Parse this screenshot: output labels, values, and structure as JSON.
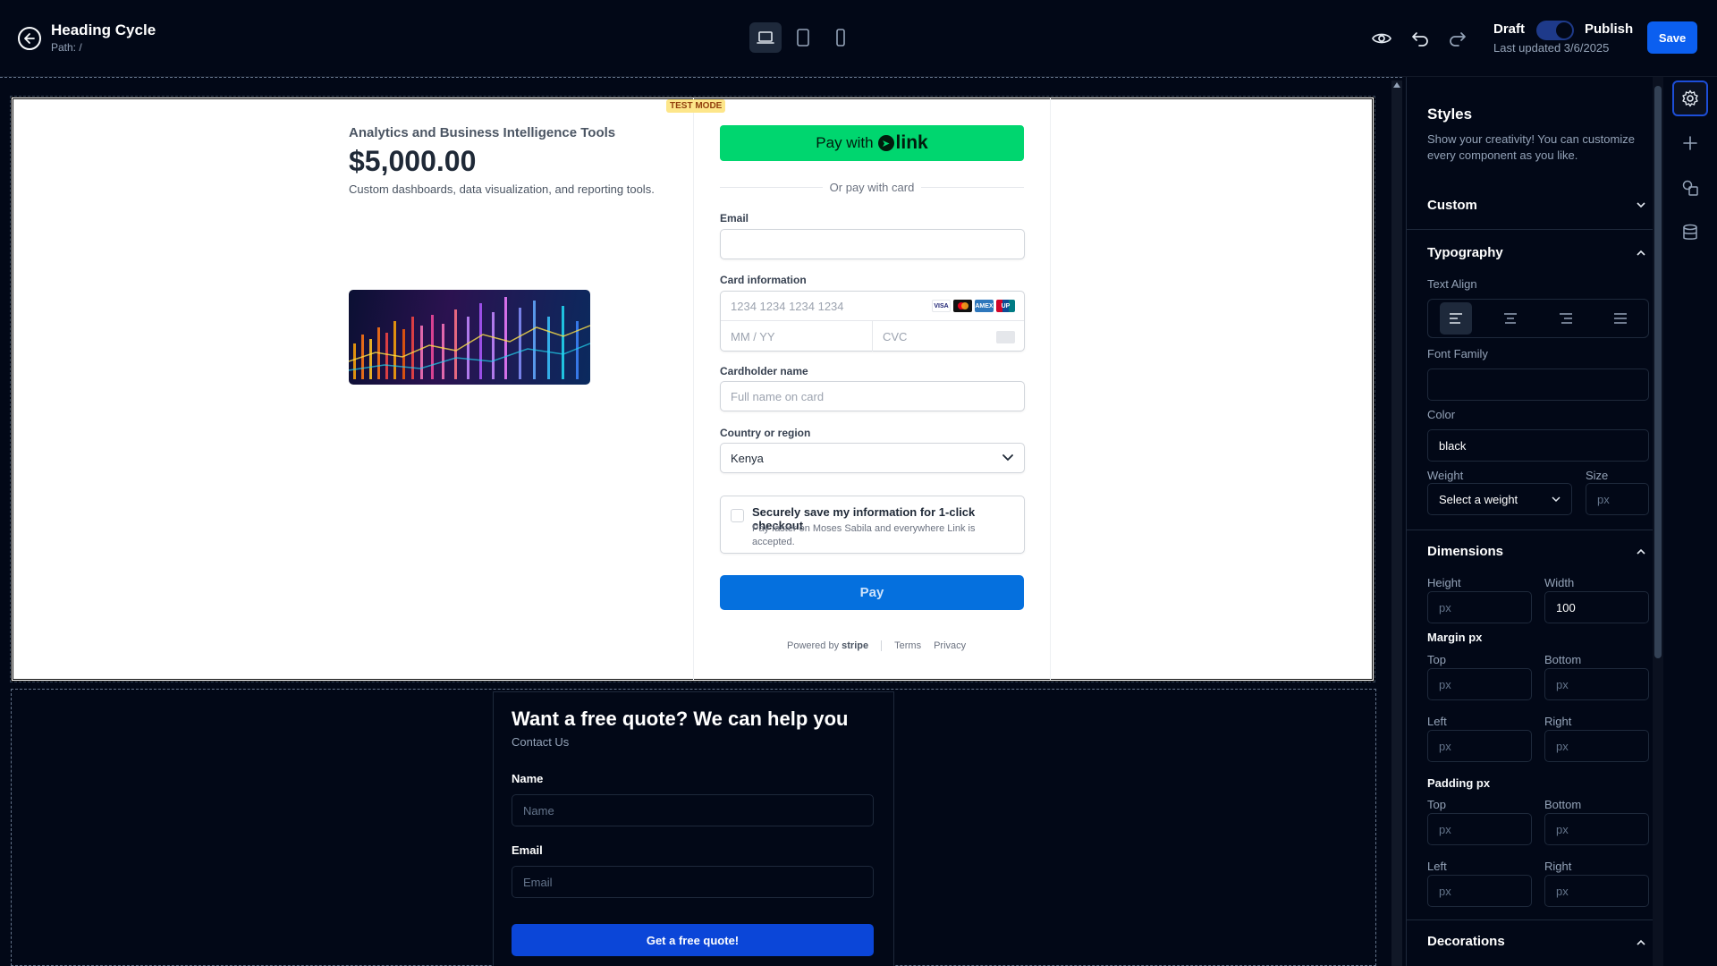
{
  "header": {
    "title": "Heading Cycle",
    "path": "Path: /",
    "draft_label": "Draft",
    "publish_label": "Publish",
    "last_updated": "Last updated 3/6/2025",
    "save_label": "Save"
  },
  "checkout": {
    "test_mode": "TEST MODE",
    "product_name": "Analytics and Business Intelligence Tools",
    "price": "$5,000.00",
    "description": "Custom dashboards, data visualization, and reporting tools.",
    "link_pay_prefix": "Pay with",
    "link_brand": "link",
    "or_pay_with_card": "Or pay with card",
    "email_label": "Email",
    "card_info_label": "Card information",
    "card_number_placeholder": "1234 1234 1234 1234",
    "expiry_placeholder": "MM / YY",
    "cvc_placeholder": "CVC",
    "card_brands": [
      "VISA",
      "MC",
      "AMEX",
      "UP"
    ],
    "cardholder_label": "Cardholder name",
    "cardholder_placeholder": "Full name on card",
    "country_label": "Country or region",
    "country_value": "Kenya",
    "save_info_title": "Securely save my information for 1-click checkout",
    "save_info_sub": "Pay faster on Moses Sabila and everywhere Link is accepted.",
    "pay_label": "Pay",
    "powered_by": "Powered by",
    "stripe": "stripe",
    "terms": "Terms",
    "privacy": "Privacy"
  },
  "quote": {
    "title": "Want a free quote? We can help you",
    "subtitle": "Contact Us",
    "name_label": "Name",
    "name_placeholder": "Name",
    "email_label": "Email",
    "email_placeholder": "Email",
    "button": "Get a free quote!"
  },
  "panel": {
    "title": "Styles",
    "description": "Show your creativity! You can customize every component as you like.",
    "custom": "Custom",
    "typography": "Typography",
    "text_align": "Text Align",
    "font_family": "Font Family",
    "color_label": "Color",
    "color_value": "black",
    "weight_label": "Weight",
    "weight_value": "Select a weight",
    "size_label": "Size",
    "px": "px",
    "dimensions": "Dimensions",
    "height_label": "Height",
    "width_label": "Width",
    "width_value": "100",
    "margin_label": "Margin px",
    "padding_label": "Padding px",
    "top": "Top",
    "bottom": "Bottom",
    "left": "Left",
    "right": "Right",
    "decorations": "Decorations"
  },
  "colors": {
    "accent": "#0b5ff0",
    "link_green": "#00d66f",
    "pay_blue": "#0570de",
    "quote_btn": "#0b46d8",
    "bg": "#020817"
  }
}
